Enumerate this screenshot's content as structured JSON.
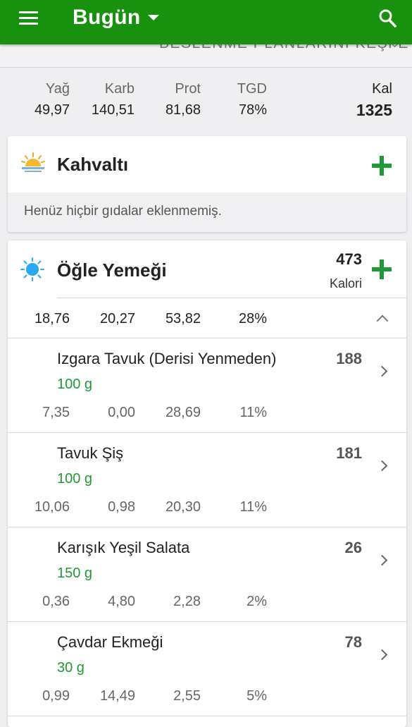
{
  "header": {
    "title": "Bugün"
  },
  "banner": {
    "text": "BESLENME PLANLARINI KEŞFET"
  },
  "summary": {
    "labels": {
      "fat": "Yağ",
      "carb": "Karb",
      "prot": "Prot",
      "tgd": "TGD",
      "kal": "Kal"
    },
    "values": {
      "fat": "49,97",
      "carb": "140,51",
      "prot": "81,68",
      "tgd": "78%",
      "kal": "1325"
    }
  },
  "breakfast": {
    "title": "Kahvaltı",
    "empty": "Henüz hiçbir gıdalar eklenmemiş."
  },
  "lunch": {
    "title": "Öğle Yemeği",
    "calories": "473",
    "calories_label": "Kalori",
    "macros": [
      "18,76",
      "20,27",
      "53,82",
      "28%"
    ],
    "foods": [
      {
        "name": "Izgara Tavuk (Derisi Yenmeden)",
        "portion": "100  g",
        "kal": "188",
        "macros": [
          "7,35",
          "0,00",
          "28,69",
          "11%"
        ]
      },
      {
        "name": "Tavuk Şiş",
        "portion": "100  g",
        "kal": "181",
        "macros": [
          "10,06",
          "0,98",
          "20,30",
          "11%"
        ]
      },
      {
        "name": "Karışık Yeşil Salata",
        "portion": "150  g",
        "kal": "26",
        "macros": [
          "0,36",
          "4,80",
          "2,28",
          "2%"
        ]
      },
      {
        "name": "Çavdar Ekmeği",
        "portion": "30  g",
        "kal": "78",
        "macros": [
          "0,99",
          "14,49",
          "2,55",
          "5%"
        ]
      }
    ]
  },
  "colors": {
    "appbar": "#17910e",
    "accent": "#1f9a36",
    "background": "#efeff1"
  },
  "icons": [
    "menu-icon",
    "dropdown-caret-icon",
    "search-icon",
    "sunrise-icon",
    "sun-icon",
    "add-icon",
    "chevron-up-icon",
    "chevron-right-icon"
  ]
}
